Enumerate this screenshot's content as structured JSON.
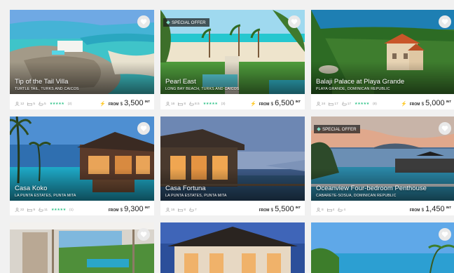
{
  "listings": [
    {
      "title": "Tip of the Tail Villa",
      "location": "TURTLE TAIL, TURKS AND CAICOS",
      "guests": "12",
      "bedrooms": "5",
      "bathrooms": "5",
      "reviews": "(2)",
      "stars": "★★★★★",
      "badge": "",
      "instant": true,
      "from": "FROM",
      "currency": "$",
      "amount": "3,500",
      "unit": "INT"
    },
    {
      "title": "Pearl East",
      "location": "LONG BAY BEACH, TURKS AND CAICOS",
      "guests": "16",
      "bedrooms": "8",
      "bathrooms": "8.5",
      "reviews": "(3)",
      "stars": "★★★★★",
      "badge": "SPECIAL OFFER",
      "instant": true,
      "from": "FROM",
      "currency": "$",
      "amount": "6,500",
      "unit": "INT"
    },
    {
      "title": "Balaji Palace at Playa Grande",
      "location": "PLAYA GRANDE, DOMINICAN REPUBLIC",
      "guests": "24",
      "bedrooms": "17",
      "bathrooms": "17",
      "reviews": "(8)",
      "stars": "★★★★★",
      "badge": "",
      "instant": true,
      "from": "FROM",
      "currency": "$",
      "amount": "5,000",
      "unit": "INT"
    },
    {
      "title": "Casa Koko",
      "location": "LA PUNTA ESTATES, PUNTA MITA",
      "guests": "22",
      "bedrooms": "9",
      "bathrooms": "11",
      "reviews": "(1)",
      "stars": "★★★★★",
      "badge": "",
      "instant": false,
      "from": "FROM",
      "currency": "$",
      "amount": "9,300",
      "unit": "INT"
    },
    {
      "title": "Casa Fortuna",
      "location": "LA PUNTA ESTATES, PUNTA MITA",
      "guests": "16",
      "bedrooms": "8",
      "bathrooms": "7",
      "reviews": "",
      "stars": "",
      "badge": "",
      "instant": false,
      "from": "FROM",
      "currency": "$",
      "amount": "5,500",
      "unit": "INT"
    },
    {
      "title": "Oceanview Four-bedroom Penthouse",
      "location": "CABARETE-SOSUA, DOMINICAN REPUBLIC",
      "guests": "8",
      "bedrooms": "4",
      "bathrooms": "4",
      "reviews": "",
      "stars": "",
      "badge": "SPECIAL OFFER",
      "instant": false,
      "from": "FROM",
      "currency": "$",
      "amount": "1,450",
      "unit": "INT"
    }
  ],
  "colors": {
    "star": "#35c58c",
    "bolt": "#f2b620",
    "badge_bg": "#1e1e1e"
  },
  "icons": {
    "favorite": "heart-icon",
    "guests": "guests-icon",
    "bedrooms": "bed-icon",
    "bathrooms": "bath-icon",
    "instant": "lightning-icon",
    "offer": "diamond-icon"
  }
}
